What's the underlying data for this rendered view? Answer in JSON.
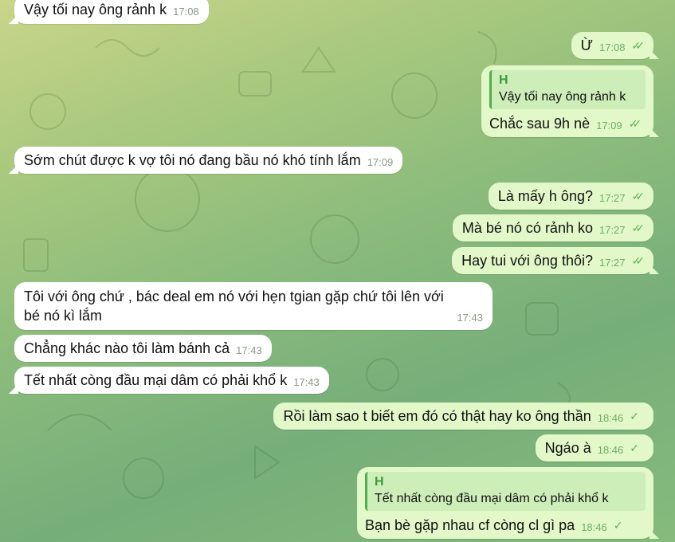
{
  "colors": {
    "incoming_bubble": "#ffffff",
    "outgoing_bubble": "#e2f8c8",
    "check": "#5cb05a",
    "quote_accent": "#4fae4e"
  },
  "messages": [
    {
      "text": "Vậy tối nay ông rảnh k",
      "time": "17:08"
    },
    {
      "text": "Ừ",
      "time": "17:08",
      "status": "read"
    },
    {
      "reply_name": "H",
      "reply_text": "Vậy tối nay ông rảnh k",
      "text": "Chắc sau 9h nè",
      "time": "17:09",
      "status": "read"
    },
    {
      "text": "Sớm chút được k vợ tôi nó đang bầu nó khó tính lắm",
      "time": "17:09"
    },
    {
      "text": "Là mấy h ông?",
      "time": "17:27",
      "status": "read"
    },
    {
      "text": "Mà bé nó có rảnh ko",
      "time": "17:27",
      "status": "read"
    },
    {
      "text": "Hay tui với ông thôi?",
      "time": "17:27",
      "status": "read"
    },
    {
      "text_line1": "Tôi với ông chứ , bác deal em nó với hẹn tgian gặp chứ tôi lên với",
      "text_line2": "bé nó kì lắm",
      "time": "17:43"
    },
    {
      "text": "Chẳng khác nào tôi làm bánh cả",
      "time": "17:43"
    },
    {
      "text": "Tết nhất còng đầu mại dâm có phải khổ k",
      "time": "17:43"
    },
    {
      "text": "Rồi làm sao t biết em đó có thật hay ko ông thần",
      "time": "18:46",
      "status": "sent"
    },
    {
      "text": "Ngáo à",
      "time": "18:46",
      "status": "sent"
    },
    {
      "reply_name": "H",
      "reply_text": "Tết nhất còng đầu mại dâm có phải khổ k",
      "text": "Bạn bè gặp nhau cf còng cl gì pa",
      "time": "18:46",
      "status": "sent"
    }
  ]
}
